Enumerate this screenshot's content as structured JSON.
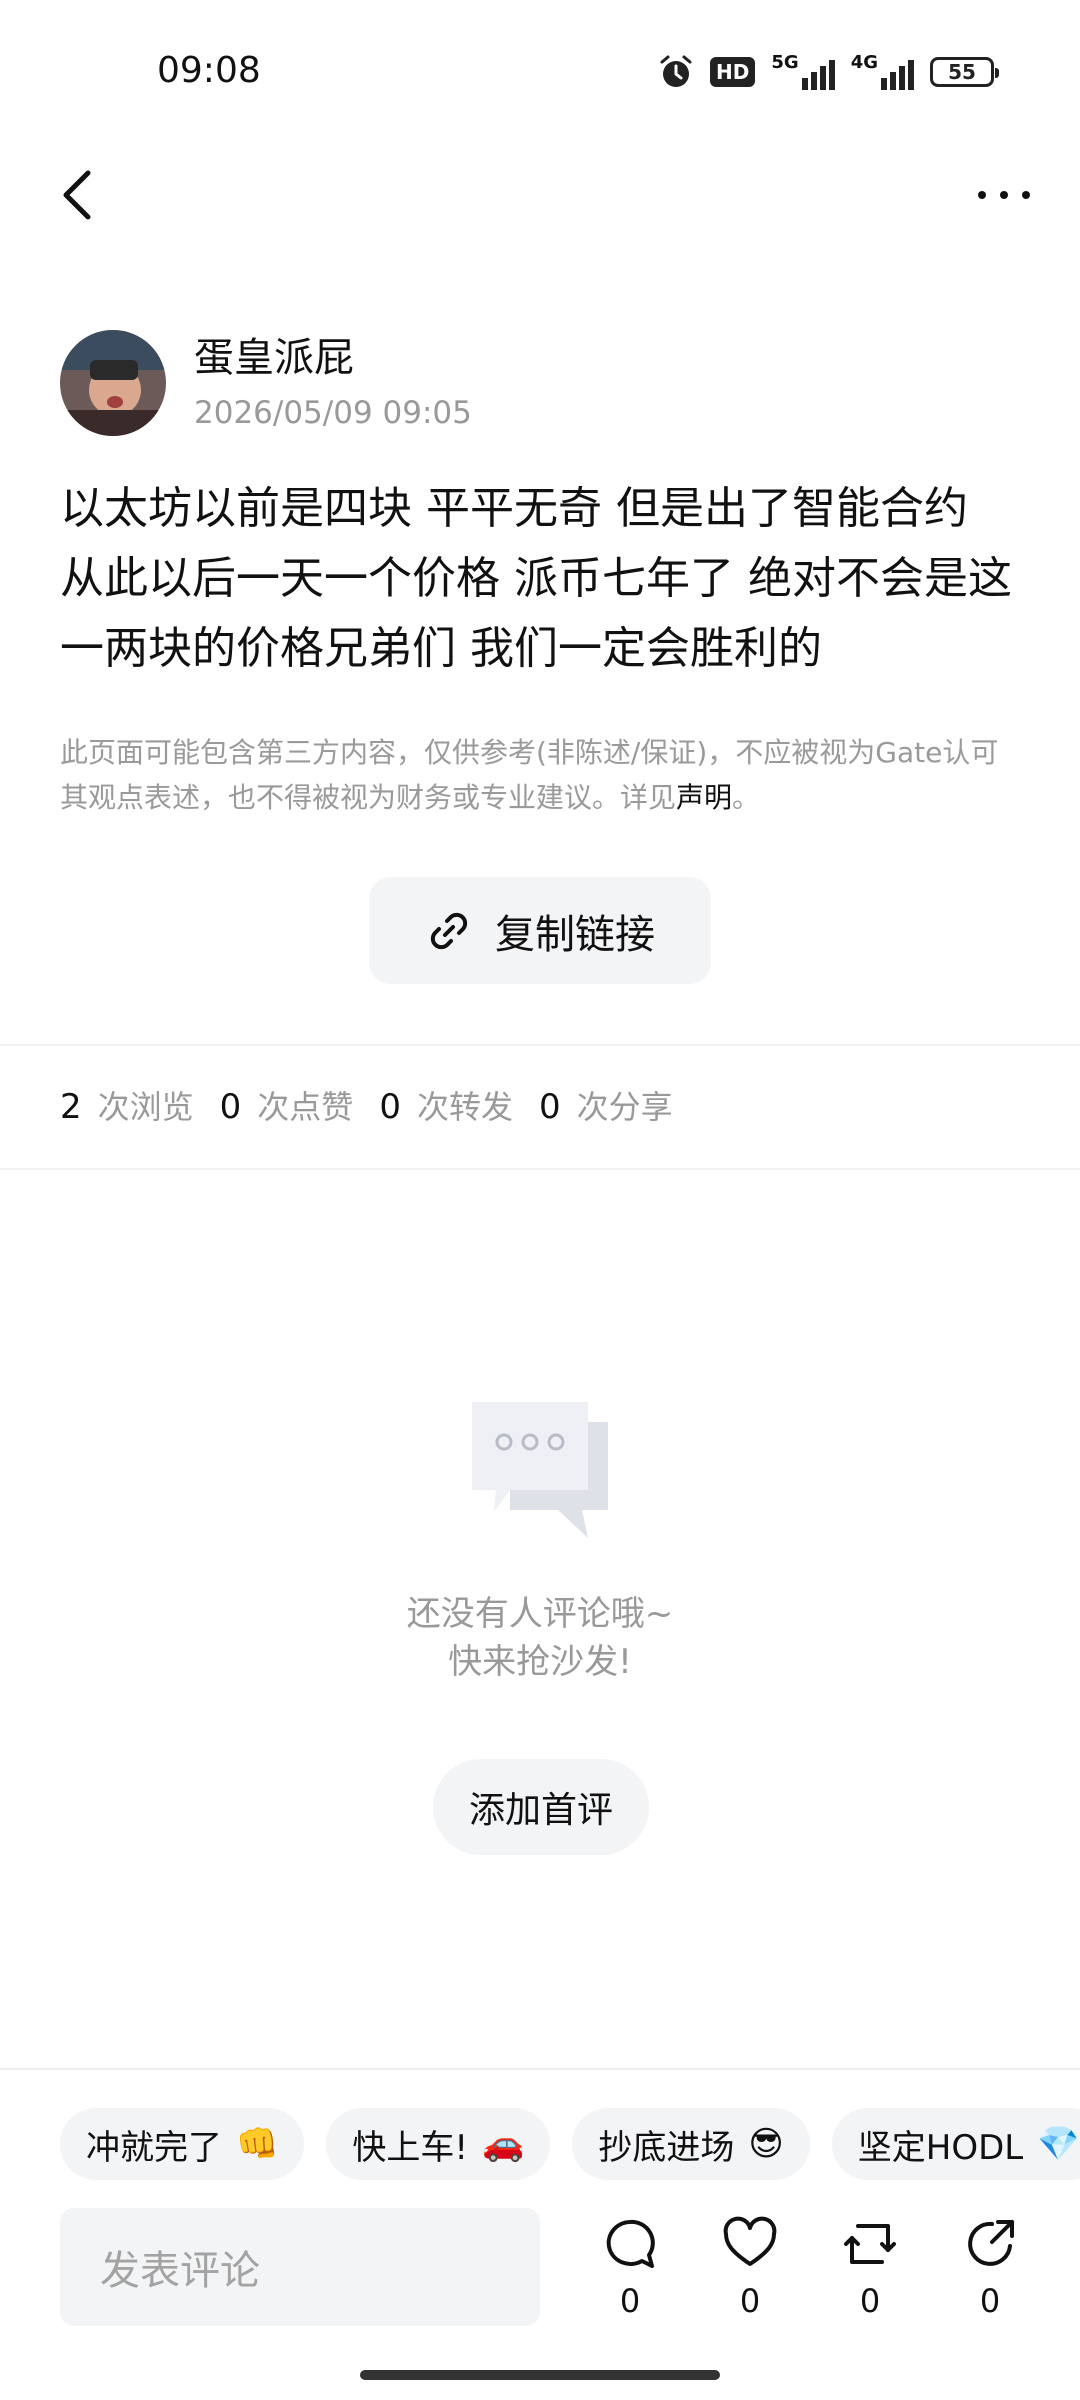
{
  "status_bar": {
    "time": "09:08",
    "hd_label": "HD",
    "net1": "5G",
    "net2": "4G",
    "battery": "55"
  },
  "post": {
    "author_name": "蛋皇派屁",
    "time": "2026/05/09 09:05",
    "content": "以太坊以前是四块 平平无奇 但是出了智能合约 从此以后一天一个价格 派币七年了 绝对不会是这一两块的价格兄弟们 我们一定会胜利的",
    "disclaimer_text": "此页面可能包含第三方内容，仅供参考(非陈述/保证)，不应被视为Gate认可其观点表述，也不得被视为财务或专业建议。详见",
    "disclaimer_link": "声明",
    "disclaimer_end": "。",
    "copy_link_label": "复制链接"
  },
  "stats": {
    "views": "2",
    "views_label": "次浏览",
    "likes": "0",
    "likes_label": "次点赞",
    "reposts": "0",
    "reposts_label": "次转发",
    "shares": "0",
    "shares_label": "次分享"
  },
  "empty_state": {
    "line1": "还没有人评论哦~",
    "line2": "快来抢沙发!",
    "button": "添加首评"
  },
  "quick_replies": [
    {
      "text": "冲就完了",
      "emoji": "👊"
    },
    {
      "text": "快上车!",
      "emoji": "🚗"
    },
    {
      "text": "抄底进场",
      "emoji": "😎"
    },
    {
      "text": "坚定HODL",
      "emoji": "💎"
    }
  ],
  "comment": {
    "placeholder": "发表评论"
  },
  "actions": {
    "comments": "0",
    "likes": "0",
    "reposts": "0",
    "shares": "0"
  },
  "icons": {
    "back": "chevron-left-icon",
    "more": "more-horizontal-icon",
    "link": "link-icon",
    "comment": "comment-icon",
    "like": "heart-icon",
    "repost": "repost-icon",
    "share": "share-icon"
  }
}
